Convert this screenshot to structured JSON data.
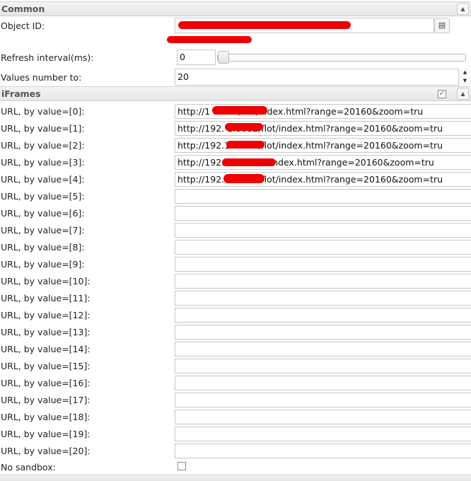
{
  "common": {
    "title": "Common",
    "object_id_label": "Object ID:",
    "object_id_value": "",
    "refresh_label": "Refresh interval(ms):",
    "refresh_value": "0",
    "values_label": "Values number to:",
    "values_value": "20"
  },
  "iframes": {
    "title": "iFrames",
    "enabled": true,
    "rows": [
      {
        "label": "URL, by value=[0]:",
        "value": "http://1          :8082/flot/index.html?range=20160&zoom=tru"
      },
      {
        "label": "URL, by value=[1]:",
        "value": "http://192.         1:8082/flot/index.html?range=20160&zoom=tru"
      },
      {
        "label": "URL, by value=[2]:",
        "value": "http://192.1       :8082/flot/index.html?range=20160&zoom=tru"
      },
      {
        "label": "URL, by value=[3]:",
        "value": "http://192.          8082/flot/index.html?range=20160&zoom=tru"
      },
      {
        "label": "URL, by value=[4]:",
        "value": "http://192.1        :8082/flot/index.html?range=20160&zoom=tru"
      },
      {
        "label": "URL, by value=[5]:",
        "value": ""
      },
      {
        "label": "URL, by value=[6]:",
        "value": ""
      },
      {
        "label": "URL, by value=[7]:",
        "value": ""
      },
      {
        "label": "URL, by value=[8]:",
        "value": ""
      },
      {
        "label": "URL, by value=[9]:",
        "value": ""
      },
      {
        "label": "URL, by value=[10]:",
        "value": ""
      },
      {
        "label": "URL, by value=[11]:",
        "value": ""
      },
      {
        "label": "URL, by value=[12]:",
        "value": ""
      },
      {
        "label": "URL, by value=[13]:",
        "value": ""
      },
      {
        "label": "URL, by value=[14]:",
        "value": ""
      },
      {
        "label": "URL, by value=[15]:",
        "value": ""
      },
      {
        "label": "URL, by value=[16]:",
        "value": ""
      },
      {
        "label": "URL, by value=[17]:",
        "value": ""
      },
      {
        "label": "URL, by value=[18]:",
        "value": ""
      },
      {
        "label": "URL, by value=[19]:",
        "value": ""
      },
      {
        "label": "URL, by value=[20]:",
        "value": ""
      }
    ],
    "no_sandbox_label": "No sandbox:",
    "no_sandbox_checked": false
  },
  "icons": {
    "collapse": "chevron-up-icon",
    "picker": "list-icon",
    "spin_up": "triangle-up-icon",
    "spin_down": "triangle-down-icon"
  },
  "colors": {
    "redaction": "#ee0000",
    "header_bg": "#e9e9e9",
    "checkbox_check": "#2b5fb3"
  }
}
